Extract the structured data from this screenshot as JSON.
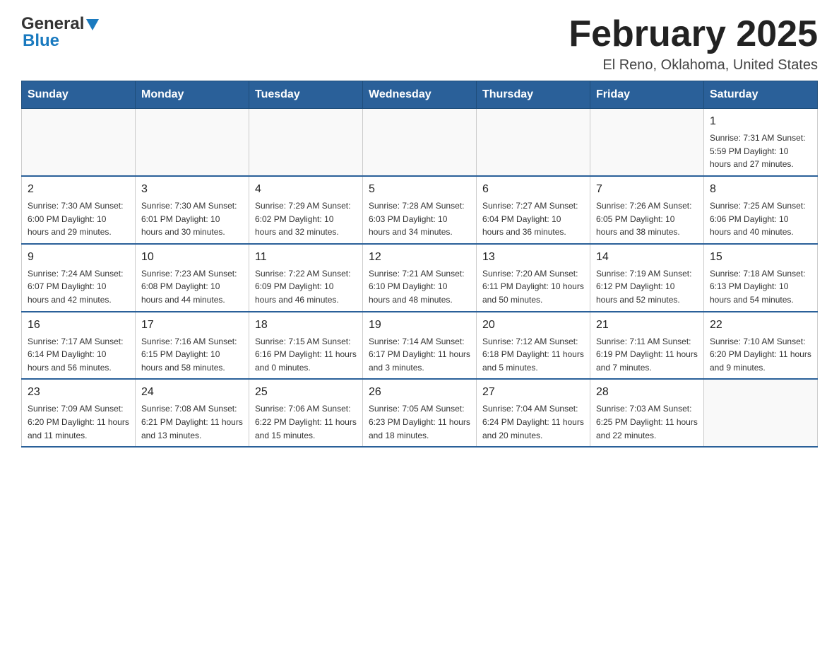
{
  "header": {
    "logo_line1": "General",
    "logo_line2": "Blue",
    "title": "February 2025",
    "subtitle": "El Reno, Oklahoma, United States"
  },
  "calendar": {
    "days_of_week": [
      "Sunday",
      "Monday",
      "Tuesday",
      "Wednesday",
      "Thursday",
      "Friday",
      "Saturday"
    ],
    "weeks": [
      [
        {
          "day": "",
          "info": ""
        },
        {
          "day": "",
          "info": ""
        },
        {
          "day": "",
          "info": ""
        },
        {
          "day": "",
          "info": ""
        },
        {
          "day": "",
          "info": ""
        },
        {
          "day": "",
          "info": ""
        },
        {
          "day": "1",
          "info": "Sunrise: 7:31 AM\nSunset: 5:59 PM\nDaylight: 10 hours and 27 minutes."
        }
      ],
      [
        {
          "day": "2",
          "info": "Sunrise: 7:30 AM\nSunset: 6:00 PM\nDaylight: 10 hours and 29 minutes."
        },
        {
          "day": "3",
          "info": "Sunrise: 7:30 AM\nSunset: 6:01 PM\nDaylight: 10 hours and 30 minutes."
        },
        {
          "day": "4",
          "info": "Sunrise: 7:29 AM\nSunset: 6:02 PM\nDaylight: 10 hours and 32 minutes."
        },
        {
          "day": "5",
          "info": "Sunrise: 7:28 AM\nSunset: 6:03 PM\nDaylight: 10 hours and 34 minutes."
        },
        {
          "day": "6",
          "info": "Sunrise: 7:27 AM\nSunset: 6:04 PM\nDaylight: 10 hours and 36 minutes."
        },
        {
          "day": "7",
          "info": "Sunrise: 7:26 AM\nSunset: 6:05 PM\nDaylight: 10 hours and 38 minutes."
        },
        {
          "day": "8",
          "info": "Sunrise: 7:25 AM\nSunset: 6:06 PM\nDaylight: 10 hours and 40 minutes."
        }
      ],
      [
        {
          "day": "9",
          "info": "Sunrise: 7:24 AM\nSunset: 6:07 PM\nDaylight: 10 hours and 42 minutes."
        },
        {
          "day": "10",
          "info": "Sunrise: 7:23 AM\nSunset: 6:08 PM\nDaylight: 10 hours and 44 minutes."
        },
        {
          "day": "11",
          "info": "Sunrise: 7:22 AM\nSunset: 6:09 PM\nDaylight: 10 hours and 46 minutes."
        },
        {
          "day": "12",
          "info": "Sunrise: 7:21 AM\nSunset: 6:10 PM\nDaylight: 10 hours and 48 minutes."
        },
        {
          "day": "13",
          "info": "Sunrise: 7:20 AM\nSunset: 6:11 PM\nDaylight: 10 hours and 50 minutes."
        },
        {
          "day": "14",
          "info": "Sunrise: 7:19 AM\nSunset: 6:12 PM\nDaylight: 10 hours and 52 minutes."
        },
        {
          "day": "15",
          "info": "Sunrise: 7:18 AM\nSunset: 6:13 PM\nDaylight: 10 hours and 54 minutes."
        }
      ],
      [
        {
          "day": "16",
          "info": "Sunrise: 7:17 AM\nSunset: 6:14 PM\nDaylight: 10 hours and 56 minutes."
        },
        {
          "day": "17",
          "info": "Sunrise: 7:16 AM\nSunset: 6:15 PM\nDaylight: 10 hours and 58 minutes."
        },
        {
          "day": "18",
          "info": "Sunrise: 7:15 AM\nSunset: 6:16 PM\nDaylight: 11 hours and 0 minutes."
        },
        {
          "day": "19",
          "info": "Sunrise: 7:14 AM\nSunset: 6:17 PM\nDaylight: 11 hours and 3 minutes."
        },
        {
          "day": "20",
          "info": "Sunrise: 7:12 AM\nSunset: 6:18 PM\nDaylight: 11 hours and 5 minutes."
        },
        {
          "day": "21",
          "info": "Sunrise: 7:11 AM\nSunset: 6:19 PM\nDaylight: 11 hours and 7 minutes."
        },
        {
          "day": "22",
          "info": "Sunrise: 7:10 AM\nSunset: 6:20 PM\nDaylight: 11 hours and 9 minutes."
        }
      ],
      [
        {
          "day": "23",
          "info": "Sunrise: 7:09 AM\nSunset: 6:20 PM\nDaylight: 11 hours and 11 minutes."
        },
        {
          "day": "24",
          "info": "Sunrise: 7:08 AM\nSunset: 6:21 PM\nDaylight: 11 hours and 13 minutes."
        },
        {
          "day": "25",
          "info": "Sunrise: 7:06 AM\nSunset: 6:22 PM\nDaylight: 11 hours and 15 minutes."
        },
        {
          "day": "26",
          "info": "Sunrise: 7:05 AM\nSunset: 6:23 PM\nDaylight: 11 hours and 18 minutes."
        },
        {
          "day": "27",
          "info": "Sunrise: 7:04 AM\nSunset: 6:24 PM\nDaylight: 11 hours and 20 minutes."
        },
        {
          "day": "28",
          "info": "Sunrise: 7:03 AM\nSunset: 6:25 PM\nDaylight: 11 hours and 22 minutes."
        },
        {
          "day": "",
          "info": ""
        }
      ]
    ]
  }
}
